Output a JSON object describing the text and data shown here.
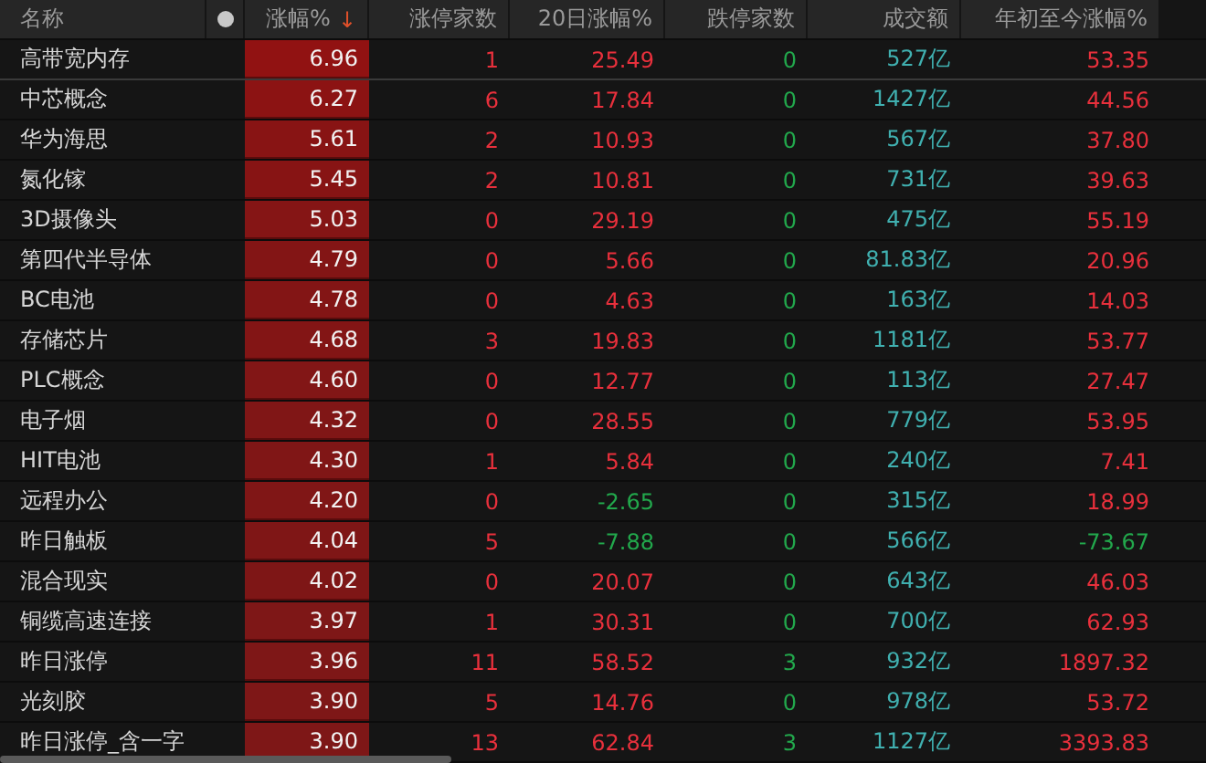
{
  "columns": [
    {
      "label": "名称",
      "kind": "name"
    },
    {
      "kind": "dot"
    },
    {
      "label": "涨幅%",
      "kind": "change",
      "sort_icon": "↓"
    },
    {
      "label": "涨停家数",
      "kind": "rise"
    },
    {
      "label": "20日涨幅%",
      "kind": "pct"
    },
    {
      "label": "跌停家数",
      "kind": "fall"
    },
    {
      "label": "成交额",
      "kind": "amount"
    },
    {
      "label": "年初至今涨幅%",
      "kind": "pct"
    }
  ],
  "rows": [
    {
      "cells": [
        "高带宽内存",
        "6.96",
        "1",
        "25.49",
        "0",
        "527亿",
        "53.35"
      ]
    },
    {
      "cells": [
        "中芯概念",
        "6.27",
        "6",
        "17.84",
        "0",
        "1427亿",
        "44.56"
      ]
    },
    {
      "cells": [
        "华为海思",
        "5.61",
        "2",
        "10.93",
        "0",
        "567亿",
        "37.80"
      ]
    },
    {
      "cells": [
        "氮化镓",
        "5.45",
        "2",
        "10.81",
        "0",
        "731亿",
        "39.63"
      ]
    },
    {
      "cells": [
        "3D摄像头",
        "5.03",
        "0",
        "29.19",
        "0",
        "475亿",
        "55.19"
      ]
    },
    {
      "cells": [
        "第四代半导体",
        "4.79",
        "0",
        "5.66",
        "0",
        "81.83亿",
        "20.96"
      ]
    },
    {
      "cells": [
        "BC电池",
        "4.78",
        "0",
        "4.63",
        "0",
        "163亿",
        "14.03"
      ]
    },
    {
      "cells": [
        "存储芯片",
        "4.68",
        "3",
        "19.83",
        "0",
        "1181亿",
        "53.77"
      ]
    },
    {
      "cells": [
        "PLC概念",
        "4.60",
        "0",
        "12.77",
        "0",
        "113亿",
        "27.47"
      ]
    },
    {
      "cells": [
        "电子烟",
        "4.32",
        "0",
        "28.55",
        "0",
        "779亿",
        "53.95"
      ]
    },
    {
      "cells": [
        "HIT电池",
        "4.30",
        "1",
        "5.84",
        "0",
        "240亿",
        "7.41"
      ]
    },
    {
      "cells": [
        "远程办公",
        "4.20",
        "0",
        "-2.65",
        "0",
        "315亿",
        "18.99"
      ]
    },
    {
      "cells": [
        "昨日触板",
        "4.04",
        "5",
        "-7.88",
        "0",
        "566亿",
        "-73.67"
      ]
    },
    {
      "cells": [
        "混合现实",
        "4.02",
        "0",
        "20.07",
        "0",
        "643亿",
        "46.03"
      ]
    },
    {
      "cells": [
        "铜缆高速连接",
        "3.97",
        "1",
        "30.31",
        "0",
        "700亿",
        "62.93"
      ]
    },
    {
      "cells": [
        "昨日涨停",
        "3.96",
        "11",
        "58.52",
        "3",
        "932亿",
        "1897.32"
      ]
    },
    {
      "cells": [
        "光刻胶",
        "3.90",
        "5",
        "14.76",
        "0",
        "978亿",
        "53.72"
      ]
    },
    {
      "cells": [
        "昨日涨停_含一字",
        "3.90",
        "13",
        "62.84",
        "3",
        "1127亿",
        "3393.83"
      ]
    }
  ]
}
